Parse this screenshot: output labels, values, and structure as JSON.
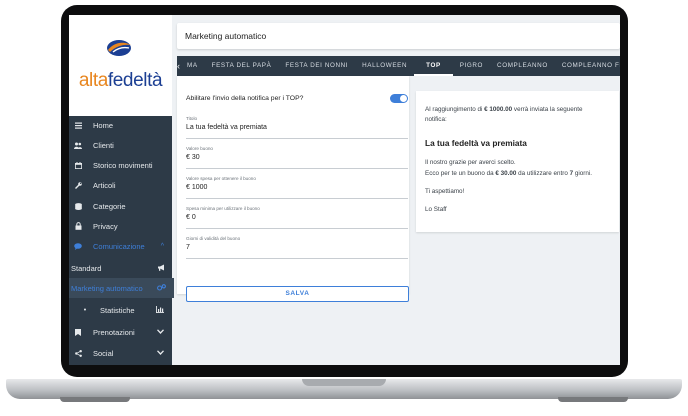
{
  "logo": {
    "text_a": "alta",
    "text_b": "fedeltà"
  },
  "sidebar": {
    "items": [
      {
        "label": "Home",
        "icon": "menu-icon"
      },
      {
        "label": "Clienti",
        "icon": "users-icon"
      },
      {
        "label": "Storico movimenti",
        "icon": "calendar-icon"
      },
      {
        "label": "Articoli",
        "icon": "wrench-icon"
      },
      {
        "label": "Categorie",
        "icon": "database-icon"
      },
      {
        "label": "Privacy",
        "icon": "lock-icon"
      },
      {
        "label": "Comunicazione",
        "icon": "chat-icon",
        "chevron": "^"
      },
      {
        "label": "Standard",
        "icon": "megaphone-icon"
      },
      {
        "label": "Marketing automatico",
        "icon": "gears-icon"
      },
      {
        "label": "Statistiche",
        "icon": "bar-chart-icon",
        "chevron": "v"
      },
      {
        "label": "Prenotazioni",
        "icon": "bookmark-icon",
        "chevron": "v"
      },
      {
        "label": "Social",
        "icon": "share-icon",
        "chevron": "v"
      }
    ]
  },
  "header": {
    "title": "Marketing automatico"
  },
  "tabs": {
    "prev_arrow": "‹",
    "items": [
      "MA",
      "FESTA DEL PAPÀ",
      "FESTA DEI NONNI",
      "HALLOWEEN",
      "TOP",
      "PIGRO",
      "COMPLEANNO",
      "COMPLEANNO FIGLI"
    ],
    "active": "TOP"
  },
  "form": {
    "toggle_label": "Abilitare l'invio della notifica per i TOP?",
    "toggle_on": true,
    "fields": [
      {
        "label": "Titolo",
        "value": "La tua fedeltà va premiata"
      },
      {
        "label": "Valore buono",
        "value": "€ 30"
      },
      {
        "label": "Valore spesa per ottenere il buono",
        "value": "€ 1000"
      },
      {
        "label": "Spesa minima per utilizzare il buono",
        "value": "€ 0"
      },
      {
        "label": "Giorni di validità del buono",
        "value": "7"
      }
    ],
    "save_label": "SALVA"
  },
  "preview": {
    "line1_pre": "Al raggiungimento di ",
    "line1_amount": "€ 1000.00",
    "line1_post": " verrà inviata la seguente",
    "line2": "notifica:",
    "title": "La tua fedeltà va premiata",
    "body1": "Il nostro grazie per averci scelto.",
    "body2_pre": "Ecco per te un buono da ",
    "body2_amount": "€ 30.00",
    "body2_mid": " da utilizzare entro ",
    "body2_days": "7",
    "body2_post": " giorni.",
    "closing": "Ti aspettiamo!",
    "signature": "Lo Staff"
  },
  "colors": {
    "sidebar": "#2d3a47",
    "accent": "#3e7fd9",
    "logo_orange": "#e8861f",
    "logo_blue": "#1c3f93"
  }
}
